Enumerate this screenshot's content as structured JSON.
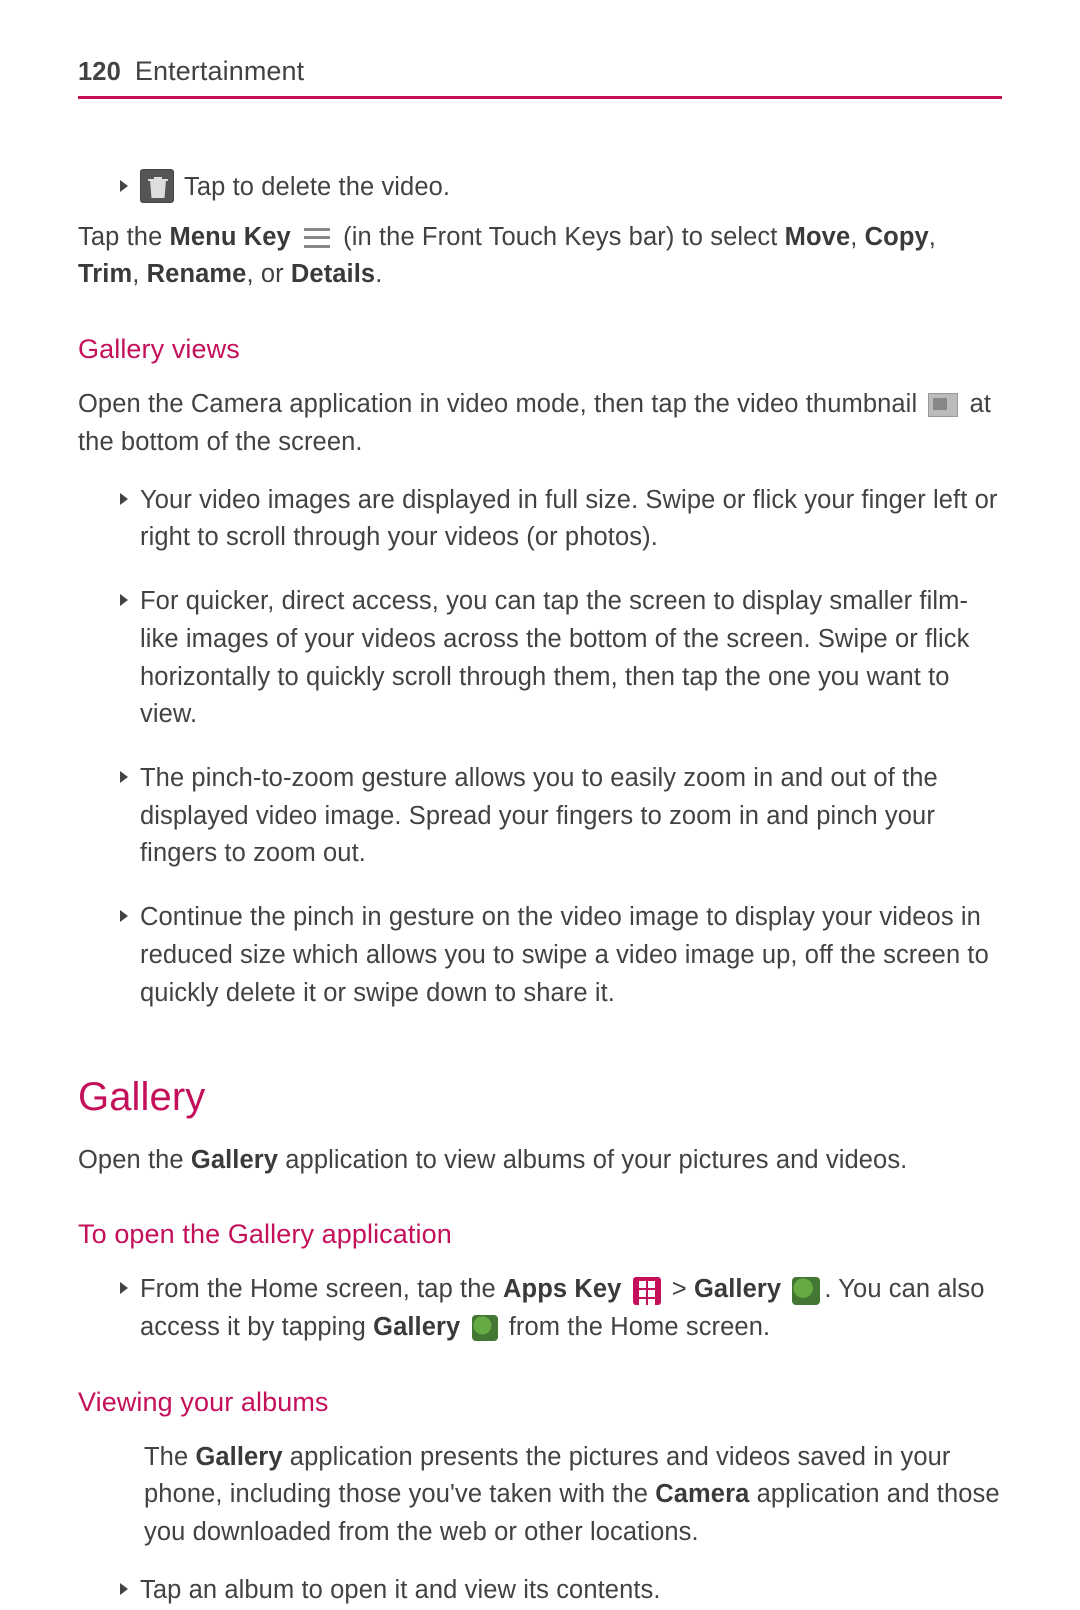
{
  "header": {
    "page": "120",
    "section": "Entertainment"
  },
  "top": {
    "delete_text": " Tap to delete the video.",
    "menu_pre": "Tap the ",
    "menu_key": "Menu Key",
    "menu_mid": " (in the Front Touch Keys bar) to select ",
    "move": "Move",
    "comma1": ", ",
    "copy": "Copy",
    "comma2": ", ",
    "trim": "Trim",
    "comma3": ", ",
    "rename": "Rename",
    "or": ", or ",
    "details": "Details",
    "period": "."
  },
  "gallery_views": {
    "heading": "Gallery views",
    "intro_pre": "Open the Camera application in video mode, then tap the video thumbnail ",
    "intro_post": " at the bottom of the screen.",
    "items": [
      "Your video images are displayed in full size. Swipe or flick your finger left or right to scroll through your videos (or photos).",
      "For quicker, direct access, you can tap the screen to display smaller film-like images of your videos across the bottom of the screen. Swipe or flick horizontally to quickly scroll through them, then tap the one you want to view.",
      "The pinch-to-zoom gesture allows you to easily zoom in and out of the displayed video image. Spread your fingers to zoom in and pinch your fingers to zoom out.",
      "Continue the pinch in gesture on the video image to display your videos in reduced size which allows you to swipe a video image up, off the screen to quickly delete it or swipe down to share it."
    ]
  },
  "gallery": {
    "heading": "Gallery",
    "intro_pre": "Open the ",
    "intro_bold": "Gallery",
    "intro_post": " application to view albums of your pictures and videos."
  },
  "open_app": {
    "heading": "To open the Gallery application",
    "pre": "From the Home screen, tap the ",
    "apps_key": "Apps Key",
    "gt": " > ",
    "gallery_bold": "Gallery",
    "post1": ". You can also access it by tapping ",
    "gallery_bold2": "Gallery",
    "post2": " from the Home screen."
  },
  "viewing": {
    "heading": "Viewing your albums",
    "para_pre": "The ",
    "gallery_bold": "Gallery",
    "para_mid": " application presents the pictures and videos saved in your phone, including those you've taken with the ",
    "camera_bold": "Camera",
    "para_post": " application and those you downloaded from the web or other locations.",
    "bullet": "Tap an album to open it and view its contents."
  }
}
